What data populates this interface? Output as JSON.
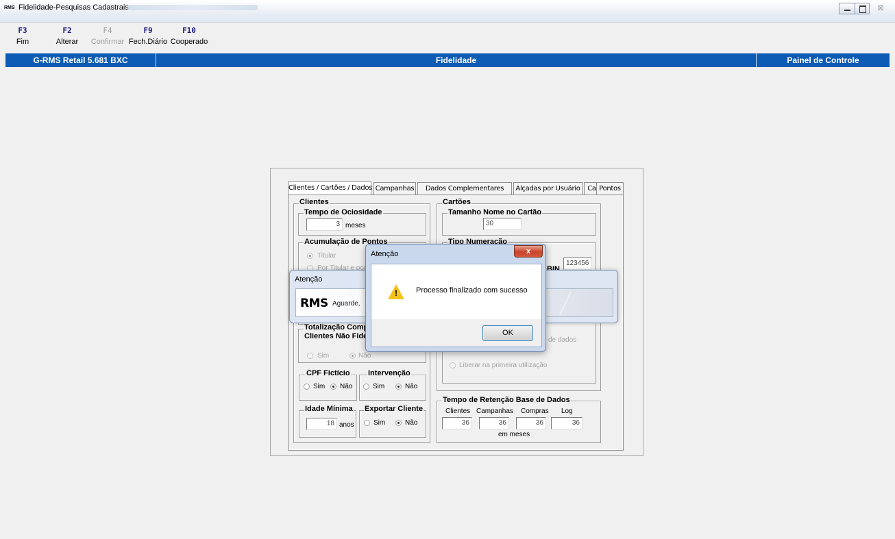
{
  "window": {
    "app_icon": "RMS",
    "title": "Fidelidade-Pesquisas Cadastrais",
    "close_glyph": "⊠"
  },
  "toolbar": {
    "keys": [
      {
        "key": "F3",
        "label": "Fim",
        "enabled": true
      },
      {
        "key": "F2",
        "label": "Alterar",
        "enabled": true
      },
      {
        "key": "F4",
        "label": "Confirmar",
        "enabled": false
      },
      {
        "key": "F9",
        "label": "Fech.Diário",
        "enabled": true
      },
      {
        "key": "F10",
        "label": "Cooperado",
        "enabled": true
      }
    ]
  },
  "header": {
    "left": "G-RMS Retail 5.681 BXC",
    "center": "Fidelidade",
    "right": "Painel de Controle"
  },
  "tabs": [
    "Clientes / Cartões / Dados",
    "Campanhas",
    "Dados Complementares",
    "Alçadas por Usuário",
    "Cartões",
    "Pontos"
  ],
  "clientes": {
    "title": "Clientes",
    "ociosidade": {
      "title": "Tempo de Ociosidade",
      "value": "3",
      "unit": "meses"
    },
    "acumulacao": {
      "title": "Acumulação de Pontos",
      "opt1": "Titular",
      "opt2": "Por Titular e por..."
    },
    "totalizacao": {
      "title1": "Totalização Comp",
      "title2": "Clientes Não Fide",
      "sim": "Sim",
      "nao": "Não"
    },
    "cpf": {
      "title": "CPF Fictício",
      "sim": "Sim",
      "nao": "Não",
      "selected": "Não"
    },
    "intervencao": {
      "title": "Intervenção",
      "sim": "Sim",
      "nao": "Não",
      "selected": "Não"
    },
    "idade": {
      "title": "Idade Mínima",
      "value": "18",
      "unit": "anos"
    },
    "exportar": {
      "title": "Exportar Cliente",
      "sim": "Sim",
      "nao": "Não",
      "selected": "Não"
    }
  },
  "cartoes": {
    "title": "Cartões",
    "tamanho": {
      "title": "Tamanho Nome no Cartão",
      "value": "30"
    },
    "numeracao": {
      "title": "Tipo Numeração",
      "bin_label": "BIN",
      "bin_value": "123456"
    },
    "base_dados_text": "de dados",
    "liberar": "Liberar na primeira utilização",
    "retencao": {
      "title": "Tempo de Retenção Base de Dados",
      "cols": [
        "Clientes",
        "Campanhas",
        "Compras",
        "Log"
      ],
      "values": [
        "36",
        "36",
        "36",
        "36"
      ],
      "unit": "em meses"
    }
  },
  "dialog_back": {
    "title": "Atenção",
    "logo": "RMS",
    "message": "Aguarde,"
  },
  "dialog_front": {
    "title": "Atenção",
    "close": "x",
    "icon": "warning-icon",
    "icon_mark": "!",
    "message": "Processo finalizado com sucesso",
    "ok": "OK"
  }
}
